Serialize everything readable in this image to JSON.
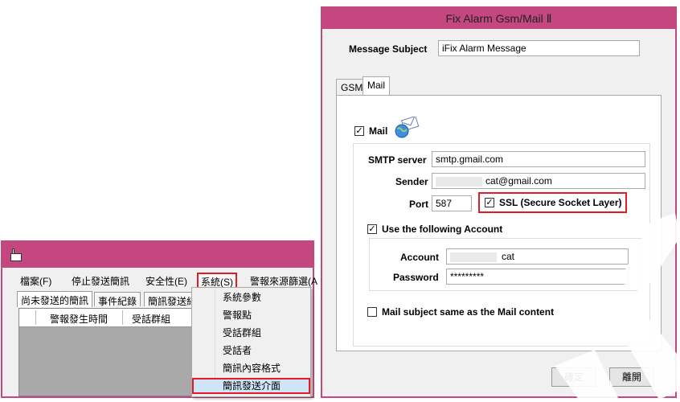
{
  "left_window": {
    "menu": [
      "檔案(F)",
      "停止發送簡訊",
      "安全性(E)",
      "系統(S)",
      "警報來源篩選(A"
    ],
    "active_menu_index": 3,
    "tabs": [
      "尚未發送的簡訊",
      "事件紀錄",
      "簡訊發送紀"
    ],
    "grid_headers": [
      "警報發生時間",
      "受話群組"
    ],
    "dropdown_items": [
      "系統參數",
      "警報點",
      "受話群組",
      "受話者",
      "簡訊內容格式",
      "簡訊發送介面"
    ],
    "dropdown_selected_index": 5,
    "accent_color": "#c4477f",
    "highlight_color": "#e21b24"
  },
  "dialog": {
    "title": "Fix Alarm Gsm/Mail Ⅱ",
    "message_subject_label": "Message  Subject",
    "message_subject_value": "iFix Alarm Message",
    "tabs": [
      "GSM",
      "Mail"
    ],
    "selected_tab": "Mail",
    "mail_checkbox_label": "Mail",
    "mail_checked": true,
    "mail_icon": "mail-globe-icon",
    "smtp_label": "SMTP server",
    "smtp_value": "smtp.gmail.com",
    "sender_label": "Sender",
    "sender_value": "cat@gmail.com",
    "port_label": "Port",
    "port_value": "587",
    "ssl_label": "SSL (Secure Socket Layer)",
    "ssl_checked": true,
    "use_account_label": "Use the following Account",
    "use_account_checked": true,
    "account_label": "Account",
    "account_value": "cat",
    "password_label": "Password",
    "password_value": "*********",
    "same_subject_label": "Mail subject same as the Mail content",
    "same_subject_checked": false,
    "ok_button": "確定",
    "close_button": "離開"
  }
}
